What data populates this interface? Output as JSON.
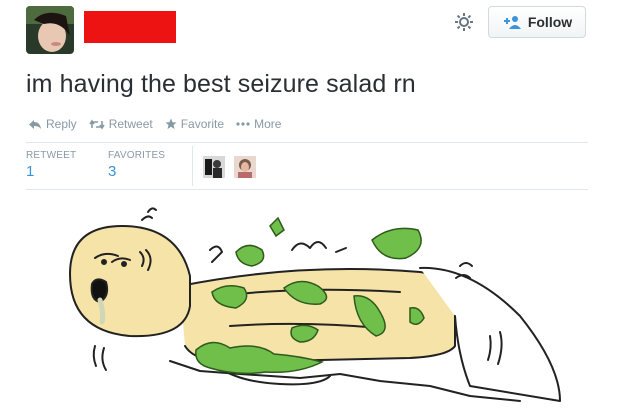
{
  "header": {
    "avatar_icon": "user-avatar-photo",
    "settings_icon": "gear-icon",
    "follow_label": "Follow",
    "follow_icon": "add-user-icon"
  },
  "tweet": {
    "text": "im having the best seizure salad rn"
  },
  "actions": [
    {
      "icon": "reply-icon",
      "label": "Reply"
    },
    {
      "icon": "retweet-icon",
      "label": "Retweet"
    },
    {
      "icon": "star-icon",
      "label": "Favorite"
    },
    {
      "icon": "more-icon",
      "label": "More"
    }
  ],
  "stats": {
    "retweets_label": "RETWEET",
    "retweets_count": "1",
    "favorites_label": "FAVORITES",
    "favorites_count": "3"
  },
  "favoriters": [
    "favoriter-avatar",
    "favoriter-avatar"
  ],
  "image": {
    "alt": "cartoon drawing of a person lying down covered in lettuce"
  },
  "colors": {
    "accent": "#3b94d9",
    "muted": "#8899a6",
    "redact": "#ee1313",
    "lettuce": "#6fbf4a",
    "skin": "#f6e3a8"
  }
}
